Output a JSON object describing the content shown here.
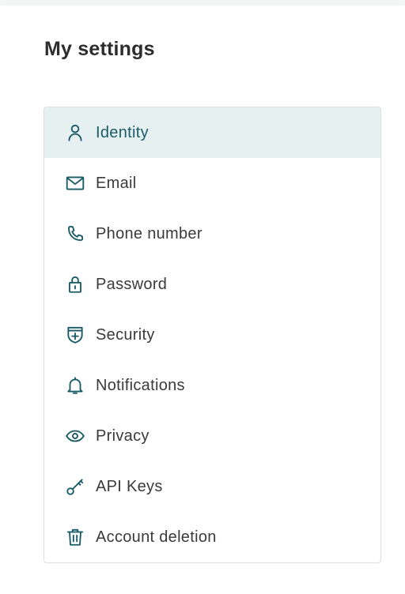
{
  "page": {
    "title": "My settings"
  },
  "menu": {
    "active_index": 0,
    "items": [
      {
        "label": "Identity",
        "icon": "person-icon"
      },
      {
        "label": "Email",
        "icon": "envelope-icon"
      },
      {
        "label": "Phone number",
        "icon": "phone-icon"
      },
      {
        "label": "Password",
        "icon": "lock-icon"
      },
      {
        "label": "Security",
        "icon": "shield-plus-icon"
      },
      {
        "label": "Notifications",
        "icon": "bell-icon"
      },
      {
        "label": "Privacy",
        "icon": "eye-icon"
      },
      {
        "label": "API Keys",
        "icon": "key-icon"
      },
      {
        "label": "Account deletion",
        "icon": "trash-icon"
      }
    ]
  },
  "colors": {
    "accent": "#175a66",
    "active_background": "#e6f0f1",
    "text": "#3a3a3a",
    "border": "#dcdfe0"
  }
}
